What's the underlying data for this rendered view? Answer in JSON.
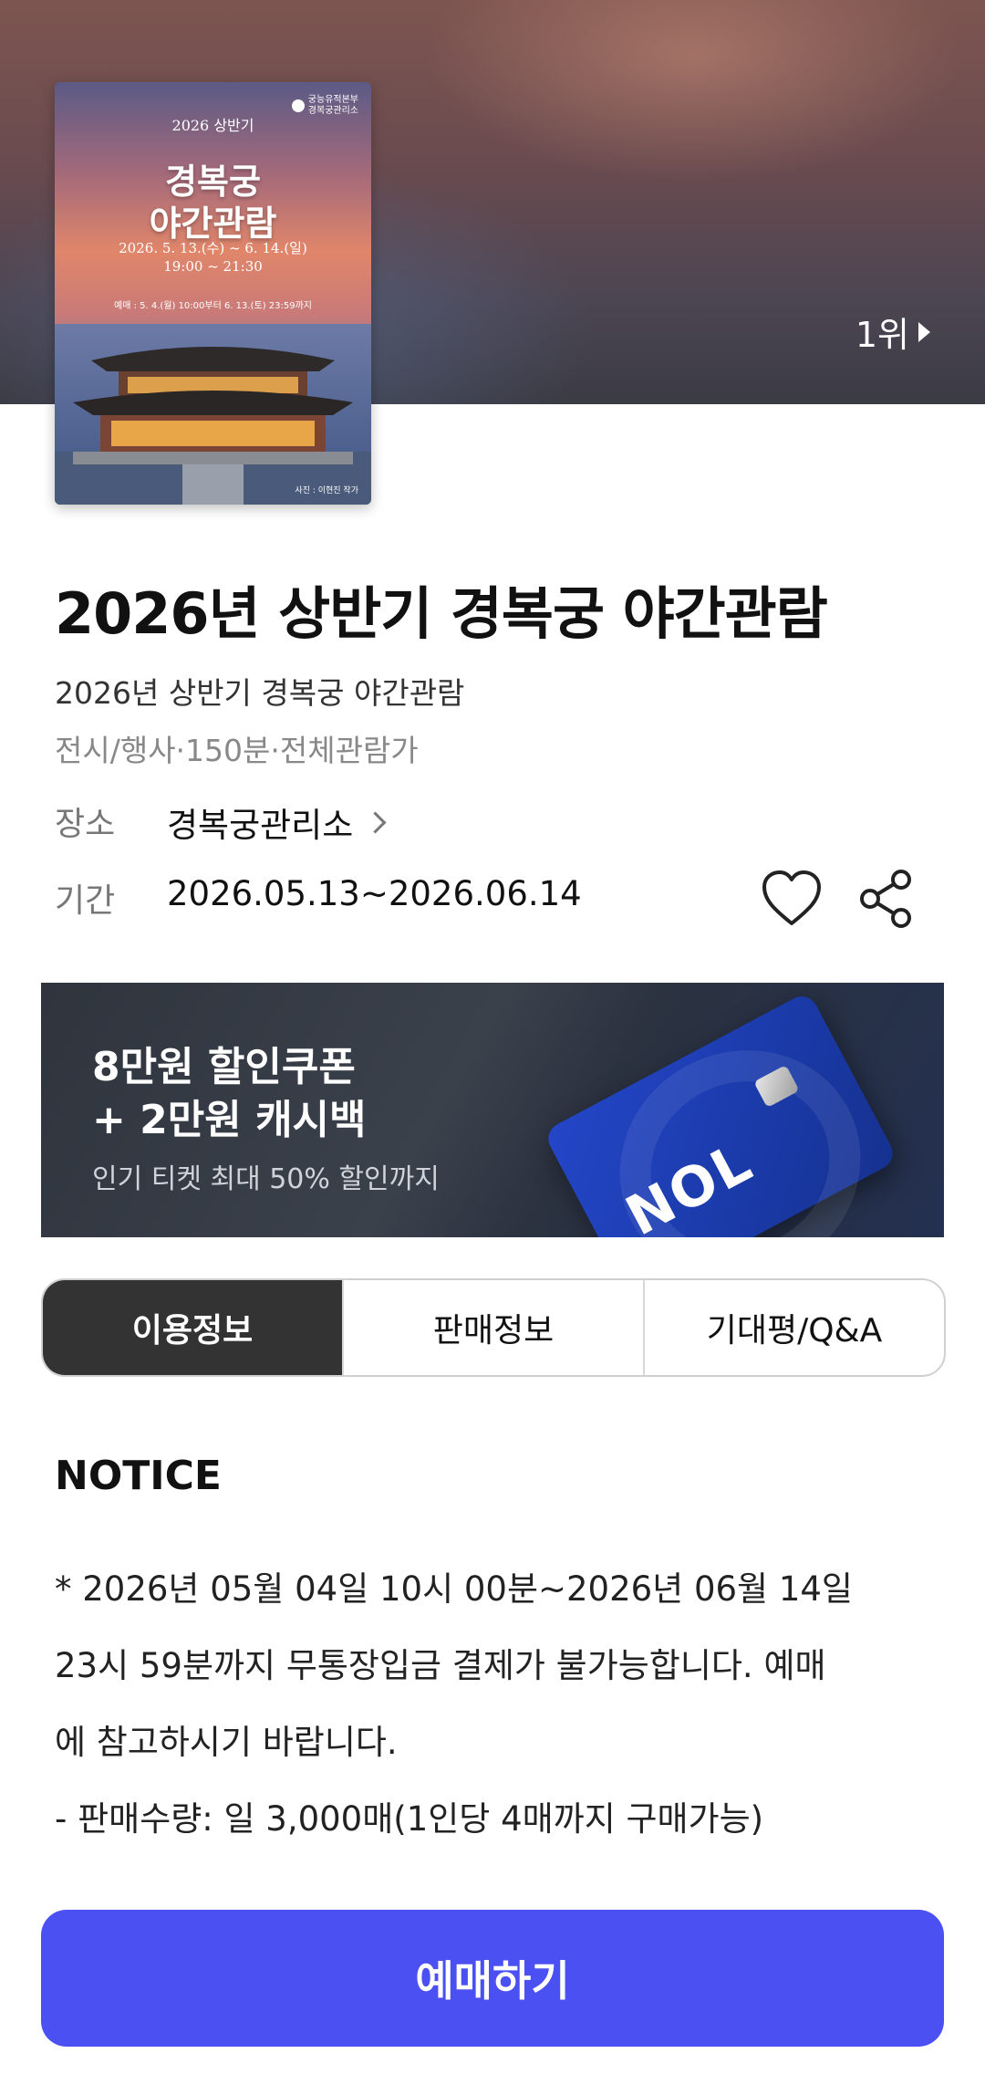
{
  "hero": {
    "rank_label": "1위",
    "poster": {
      "half_label": "2026 상반기",
      "title_line1": "경복궁",
      "title_line2": "야간관람",
      "dates_line1": "2026. 5. 13.(수) ~ 6. 14.(일)",
      "dates_line2": "19:00 ~ 21:30",
      "sale_line": "예매 : 5. 4.(월) 10:00부터 6. 13.(토) 23:59까지",
      "org_line1": "궁능유적본부",
      "org_line2": "경복궁관리소",
      "credit": "사진 : 이현진 작가"
    }
  },
  "event": {
    "title": "2026년 상반기 경복궁 야간관람",
    "subtitle": "2026년 상반기 경복궁 야간관람",
    "meta": "전시/행사·150분·전체관람가",
    "place_label": "장소",
    "place_value": "경복궁관리소",
    "period_label": "기간",
    "period_value": "2026.05.13~2026.06.14"
  },
  "banner": {
    "line1": "8만원 할인쿠폰",
    "line2": "+ 2만원 캐시백",
    "line3": "인기 티켓 최대 50% 할인까지",
    "card_text": "NOL"
  },
  "tabs": [
    "이용정보",
    "판매정보",
    "기대평/Q&A"
  ],
  "notice": {
    "heading": "NOTICE",
    "line1": "* 2026년 05월 04일 10시 00분~2026년 06월 14일",
    "line2": "23시 59분까지 무통장입금 결제가 불가능합니다. 예매",
    "line3": "에 참고하시기 바랍니다.",
    "line4": "- 판매수량: 일 3,000매(1인당 4매까지 구매가능)"
  },
  "cta": {
    "label": "예매하기"
  },
  "colors": {
    "cta": "#4b50f2",
    "active_tab": "#333333"
  },
  "icons": [
    "heart-icon",
    "share-icon",
    "chevron-right-icon",
    "rank-arrow-icon"
  ]
}
